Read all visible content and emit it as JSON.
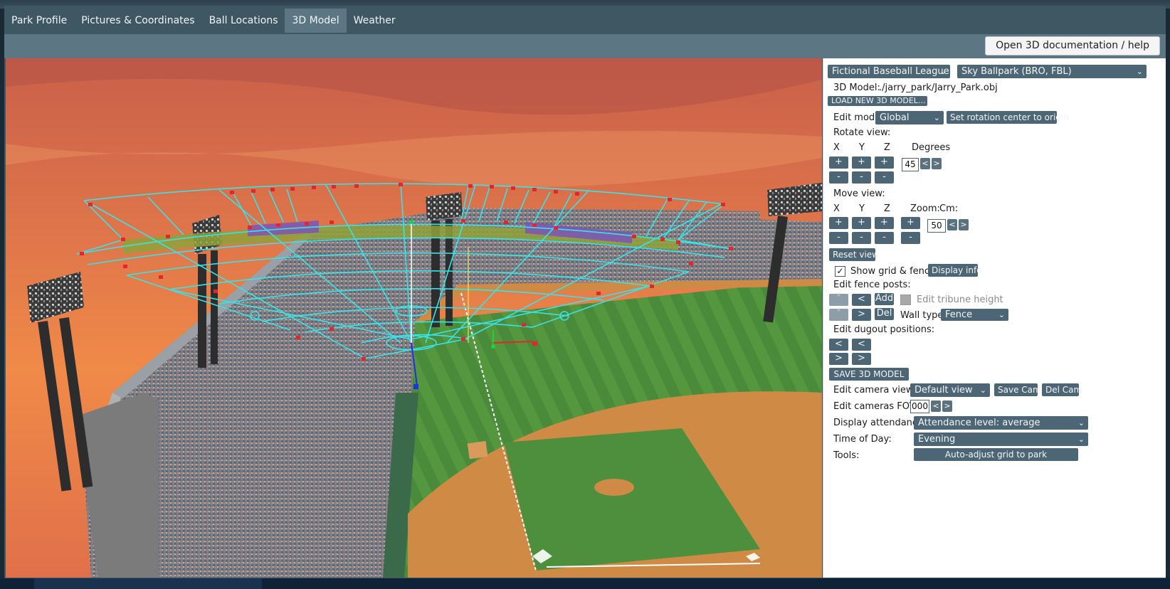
{
  "tabs": [
    {
      "label": "Park Profile",
      "active": false
    },
    {
      "label": "Pictures & Coordinates",
      "active": false
    },
    {
      "label": "Ball Locations",
      "active": false
    },
    {
      "label": "3D Model",
      "active": true
    },
    {
      "label": "Weather",
      "active": false
    }
  ],
  "toolbar": {
    "doc_button": "Open 3D documentation / help"
  },
  "panel": {
    "league_select": "Fictional Baseball League",
    "park_select": "Sky Ballpark (BRO, FBL)",
    "model_label": "3D Model:",
    "model_path": "./jarry_park/Jarry_Park.obj",
    "load_button": "LOAD NEW 3D MODEL...",
    "edit_mode_label": "Edit mode",
    "edit_mode_value": "Global",
    "rotation_center_button": "Set rotation center to origin",
    "rotate_label": "Rotate view:",
    "axis_x": "X",
    "axis_y": "Y",
    "axis_z": "Z",
    "degrees_label": "Degrees",
    "degrees_value": "45",
    "plus": "+",
    "minus": "-",
    "prev": "<",
    "next": ">",
    "move_label": "Move view:",
    "zoom_label": "Zoom:",
    "cm_label": "Cm:",
    "cm_value": "50",
    "reset_button": "Reset view",
    "show_grid_label": "Show grid & fence",
    "show_grid_checked": true,
    "display_info_button": "Display info",
    "fence_posts_label": "Edit fence posts:",
    "add_button": "Add",
    "del_button": "Del",
    "tribune_label": "Edit tribune height",
    "tribune_checked": false,
    "wall_type_label": "Wall type:",
    "wall_type_value": "Fence",
    "dugout_label": "Edit dugout positions:",
    "save_model_button": "SAVE 3D MODEL",
    "camera_views_label": "Edit camera views:",
    "camera_views_value": "Default view",
    "save_cam_button": "Save Cam",
    "del_cam_button": "Del Cam",
    "fov_label": "Edit cameras FOV:",
    "fov_value": "000",
    "attendance_label": "Display attendance:",
    "attendance_value": "Attendance level: average",
    "time_label": "Time of Day:",
    "time_value": "Evening",
    "tools_label": "Tools:",
    "auto_adjust_button": "Auto-adjust grid to park"
  },
  "colors": {
    "app_bg": "#3f5663",
    "toolbar_bg": "#5d7684",
    "control_bg": "#4c6675",
    "grid_line": "#37e3e8",
    "fence_post": "#e5242b",
    "field_grass": "#4b8a3c",
    "infield_dirt": "#cf8a45"
  }
}
